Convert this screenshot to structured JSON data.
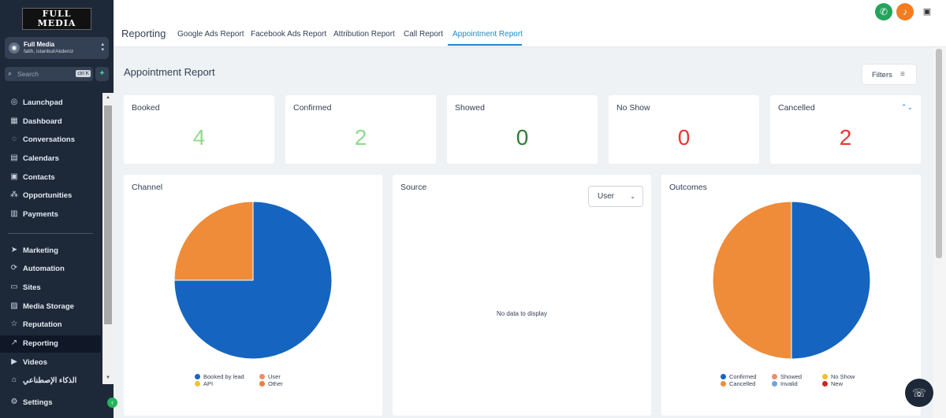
{
  "brand": {
    "logo_line1": "FULL",
    "logo_line2": "MEDIA"
  },
  "account": {
    "name": "Full Media",
    "location": "fatih, istanbul/Akdeniz"
  },
  "search": {
    "placeholder": "Search",
    "shortcut": "ctrl K"
  },
  "sidebar": {
    "items": [
      {
        "label": "Launchpad",
        "icon": "launchpad-icon"
      },
      {
        "label": "Dashboard",
        "icon": "dashboard-icon"
      },
      {
        "label": "Conversations",
        "icon": "chat-icon"
      },
      {
        "label": "Calendars",
        "icon": "calendar-icon"
      },
      {
        "label": "Contacts",
        "icon": "contacts-icon"
      },
      {
        "label": "Opportunities",
        "icon": "opportunities-icon"
      },
      {
        "label": "Payments",
        "icon": "payments-icon"
      },
      {
        "label": "Marketing",
        "icon": "send-icon"
      },
      {
        "label": "Automation",
        "icon": "automation-icon"
      },
      {
        "label": "Sites",
        "icon": "sites-icon"
      },
      {
        "label": "Media Storage",
        "icon": "media-icon"
      },
      {
        "label": "Reputation",
        "icon": "star-icon"
      },
      {
        "label": "Reporting",
        "icon": "trend-icon",
        "active": true
      },
      {
        "label": "Videos",
        "icon": "video-icon"
      },
      {
        "label": "الذكاء الإصطناعي",
        "icon": "ai-icon"
      },
      {
        "label": "Settings",
        "icon": "settings-icon"
      }
    ]
  },
  "header": {
    "section": "Reporting",
    "tabs": [
      {
        "label": "Google Ads Report"
      },
      {
        "label": "Facebook Ads Report"
      },
      {
        "label": "Attribution Report"
      },
      {
        "label": "Call Report"
      },
      {
        "label": "Appointment Report",
        "active": true
      }
    ]
  },
  "page": {
    "title": "Appointment Report",
    "filters_label": "Filters"
  },
  "stats": [
    {
      "label": "Booked",
      "value": "4",
      "color": "#8fd98f"
    },
    {
      "label": "Confirmed",
      "value": "2",
      "color": "#8fd98f"
    },
    {
      "label": "Showed",
      "value": "0",
      "color": "#2e7d32"
    },
    {
      "label": "No Show",
      "value": "0",
      "color": "#e53935"
    },
    {
      "label": "Cancelled",
      "value": "2",
      "color": "#e53935"
    }
  ],
  "panels": {
    "channel": {
      "title": "Channel"
    },
    "source": {
      "title": "Source",
      "select_value": "User",
      "empty_text": "No data to display"
    },
    "outcomes": {
      "title": "Outcomes"
    }
  },
  "chart_data": [
    {
      "type": "pie",
      "title": "Channel",
      "categories": [
        "Booked by lead",
        "User",
        "API",
        "Other"
      ],
      "values": [
        3,
        1,
        0,
        0
      ],
      "colors": [
        "#1565c0",
        "#ef8c3a",
        "#f2c12e",
        "#e9803f"
      ]
    },
    {
      "type": "pie",
      "title": "Outcomes",
      "categories": [
        "Confirmed",
        "Showed",
        "No Show",
        "Cancelled",
        "Invalid",
        "New"
      ],
      "values": [
        2,
        0,
        0,
        2,
        0,
        0
      ],
      "colors": [
        "#1565c0",
        "#ef8c6a",
        "#e9c22c",
        "#ef8c3a",
        "#6fa3e0",
        "#c62828"
      ]
    }
  ]
}
